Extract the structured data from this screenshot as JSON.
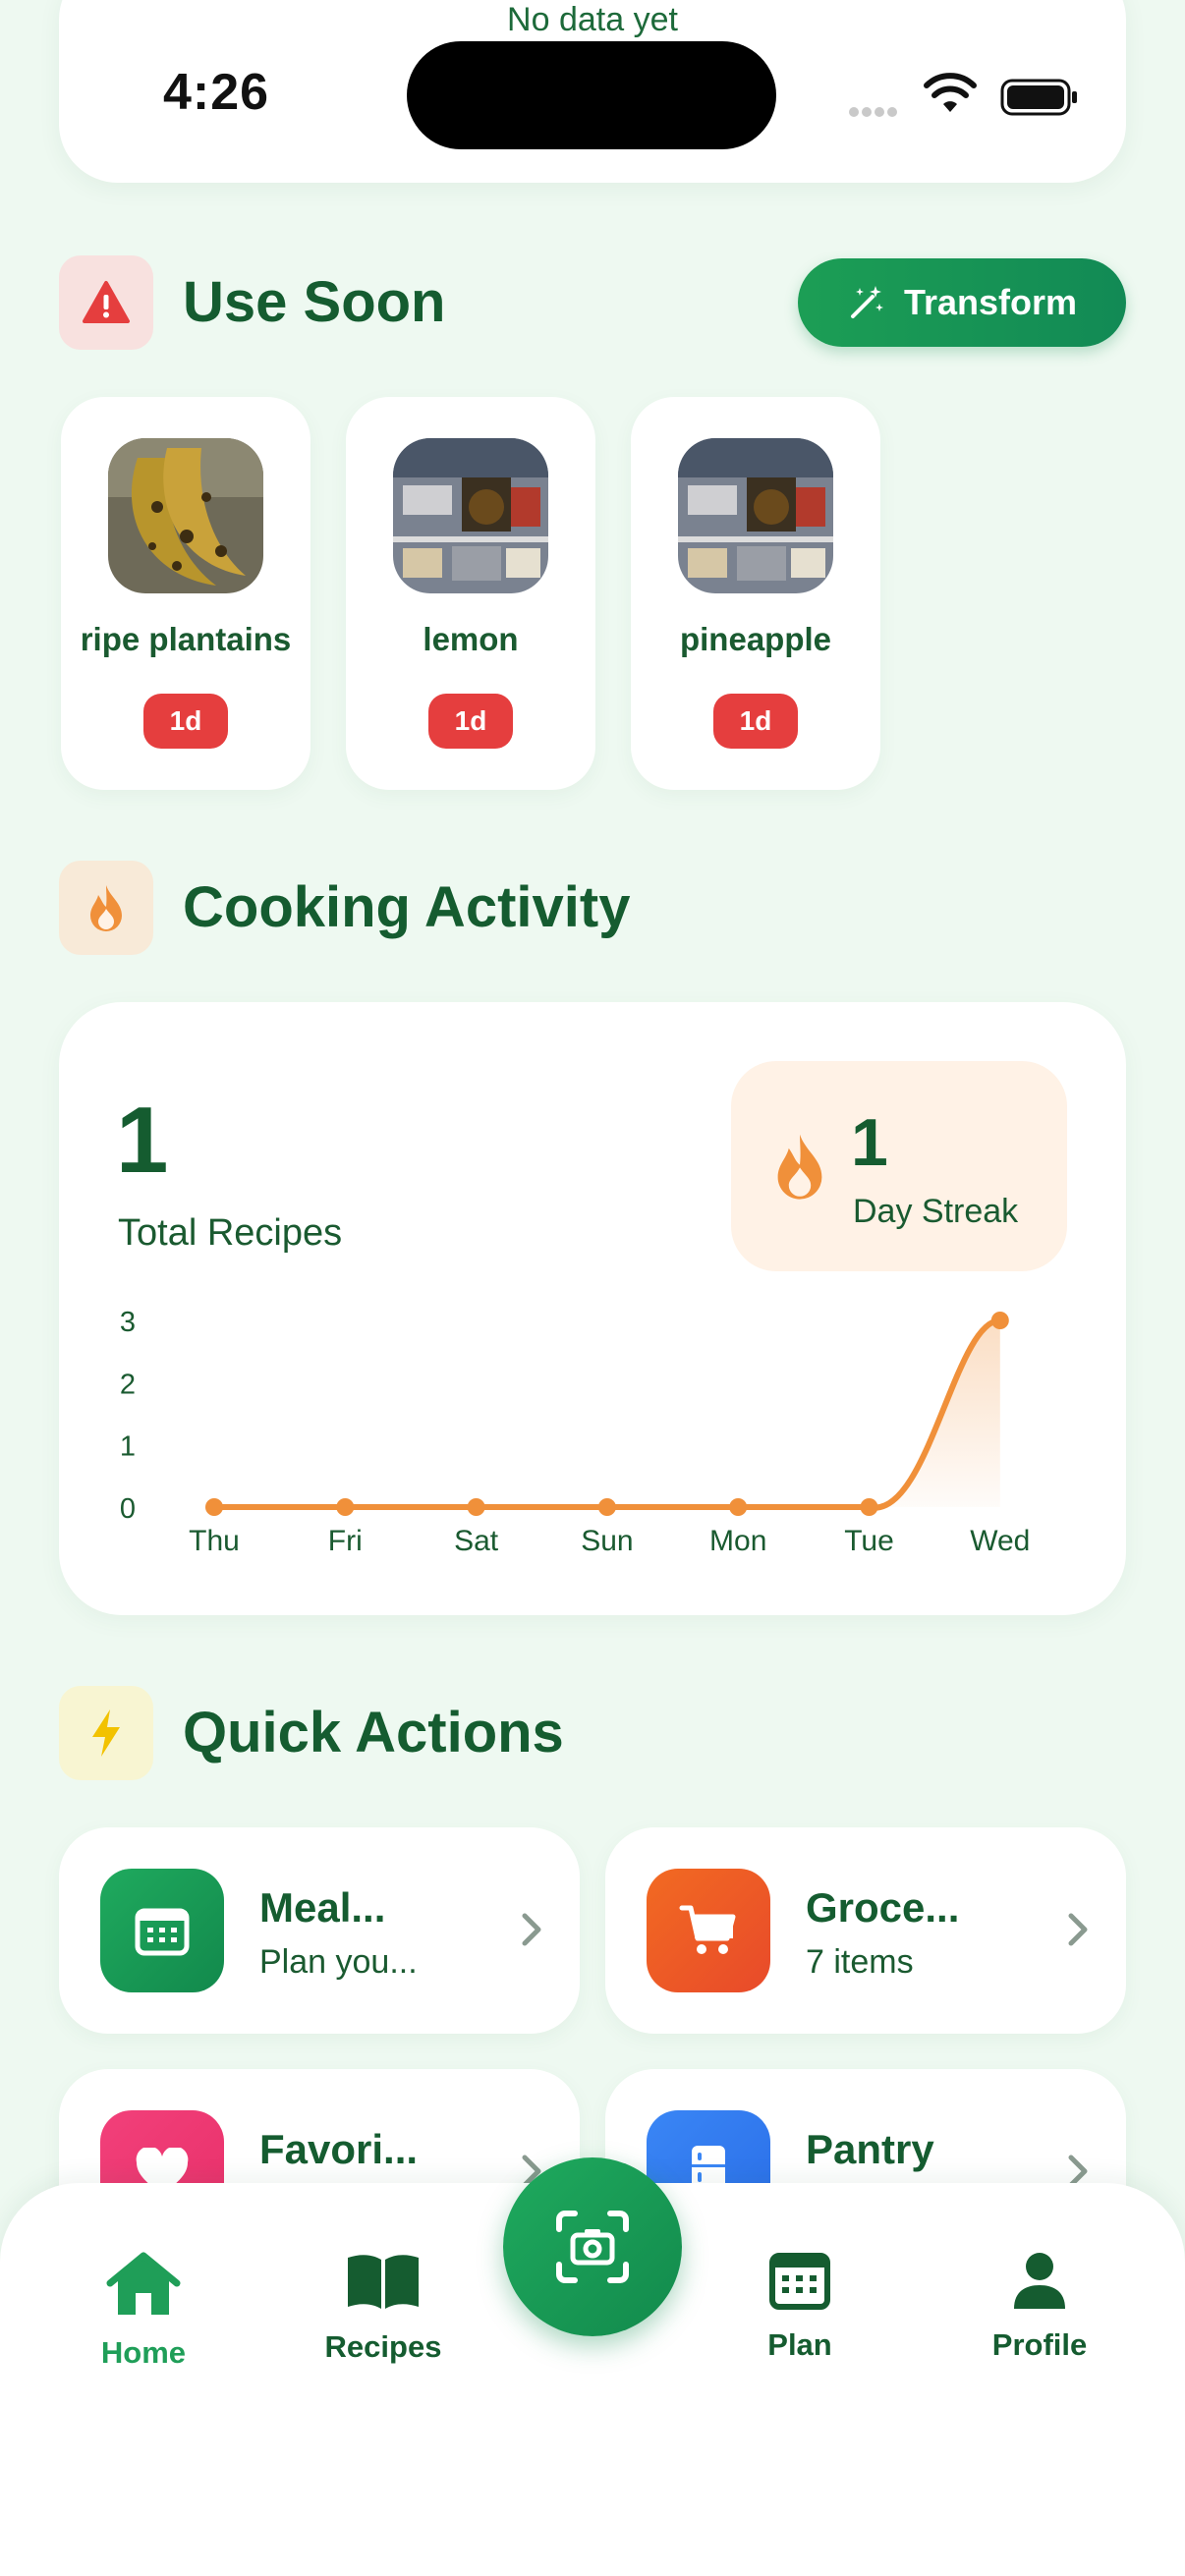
{
  "status_bar": {
    "time": "4:26"
  },
  "top_card": {
    "no_data_text": "No data yet"
  },
  "use_soon": {
    "title": "Use Soon",
    "transform_label": "Transform",
    "items": [
      {
        "name": "ripe plantains",
        "badge": "1d"
      },
      {
        "name": "lemon",
        "badge": "1d"
      },
      {
        "name": "pineapple",
        "badge": "1d"
      }
    ]
  },
  "cooking_activity": {
    "title": "Cooking Activity",
    "total_recipes_value": "1",
    "total_recipes_label": "Total Recipes",
    "streak_value": "1",
    "streak_label": "Day Streak"
  },
  "chart_data": {
    "type": "line",
    "categories": [
      "Thu",
      "Fri",
      "Sat",
      "Sun",
      "Mon",
      "Tue",
      "Wed"
    ],
    "values": [
      0,
      0,
      0,
      0,
      0,
      0,
      3
    ],
    "yticks": [
      "0",
      "1",
      "2",
      "3"
    ],
    "ylim": [
      0,
      3
    ],
    "color": "#f0903a"
  },
  "quick_actions": {
    "title": "Quick Actions",
    "items": [
      {
        "title": "Meal...",
        "subtitle": "Plan you...",
        "icon": "calendar-icon",
        "color": "#16a05a"
      },
      {
        "title": "Groce...",
        "subtitle": "7 items",
        "icon": "cart-icon",
        "color": "#ee5a24"
      },
      {
        "title": "Favori...",
        "subtitle": "",
        "icon": "heart-icon",
        "color": "#ee3b72"
      },
      {
        "title": "Pantry",
        "subtitle": "",
        "icon": "fridge-icon",
        "color": "#2f7cf0"
      }
    ]
  },
  "bottom_nav": {
    "items": [
      {
        "label": "Home",
        "icon": "home-icon"
      },
      {
        "label": "Recipes",
        "icon": "book-icon"
      },
      {
        "label": "Plan",
        "icon": "calendar-icon"
      },
      {
        "label": "Profile",
        "icon": "person-icon"
      }
    ],
    "center_action_icon": "camera-scan-icon"
  }
}
